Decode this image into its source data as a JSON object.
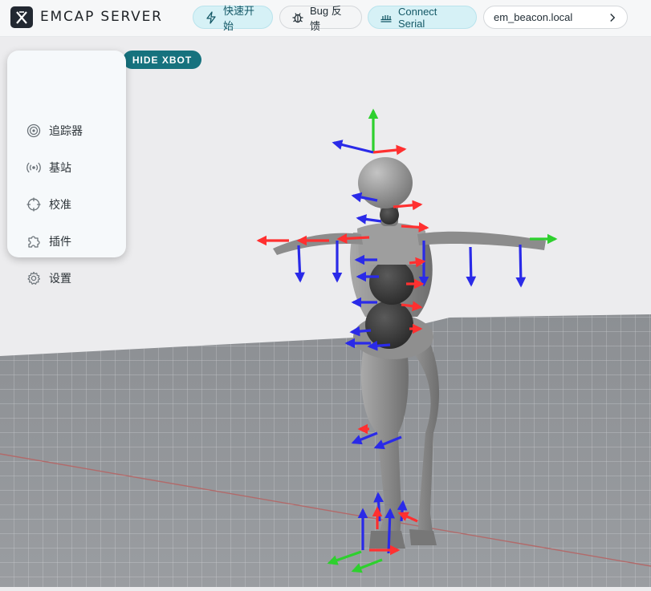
{
  "header": {
    "title": "EMCAP SERVER",
    "quick_start_label": "快速开始",
    "bug_label": "Bug 反馈",
    "serial_label": "Connect Serial",
    "host_label": "em_beacon.local"
  },
  "sidebar": {
    "items": [
      {
        "label": "追踪器",
        "icon": "target-icon"
      },
      {
        "label": "基站",
        "icon": "broadcast-icon"
      },
      {
        "label": "校准",
        "icon": "crosshair-icon"
      },
      {
        "label": "插件",
        "icon": "puzzle-icon"
      },
      {
        "label": "设置",
        "icon": "gear-icon"
      }
    ]
  },
  "viewport": {
    "hide_button_label": "HIDE XBOT"
  },
  "colors": {
    "accent": "#16727e",
    "accent_light": "#d6f1f6",
    "axis_x": "#ff3030",
    "axis_y": "#2ed02e",
    "axis_z": "#2a2ae8"
  }
}
